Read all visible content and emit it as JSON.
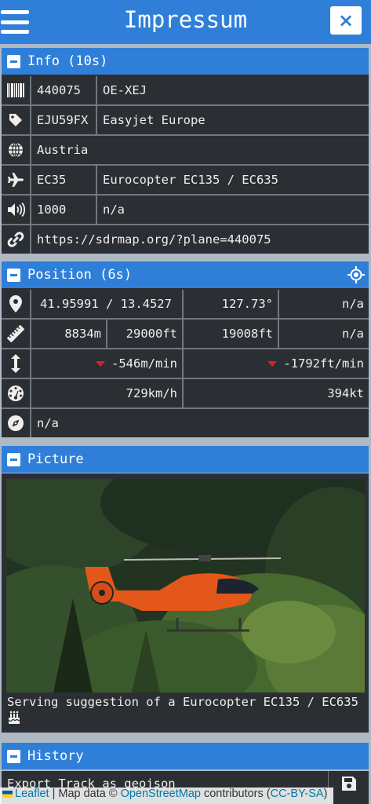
{
  "header": {
    "title": "Impressum",
    "close_label": "×"
  },
  "sections": {
    "info": {
      "title": "Info (10s)"
    },
    "position": {
      "title": "Position (6s)"
    },
    "picture": {
      "title": "Picture"
    },
    "history": {
      "title": "History"
    }
  },
  "info": {
    "hex": "440075",
    "registration": "OE-XEJ",
    "callsign": "EJU59FX",
    "operator": "Easyjet Europe",
    "country": "Austria",
    "type_code": "EC35",
    "type_name": "Eurocopter EC135 / EC635",
    "squawk": "1000",
    "squawk_extra": "n/a",
    "link": "https://sdrmap.org/?plane=440075"
  },
  "position": {
    "coords": "41.95991 / 13.4527",
    "track": "127.73°",
    "pos_extra": "n/a",
    "alt_m": "8834m",
    "alt_ft": "29000ft",
    "geo_alt_ft": "19008ft",
    "alt_extra": "n/a",
    "vrate_m": "-546m/min",
    "vrate_ft": "-1792ft/min",
    "speed_kmh": "729km/h",
    "speed_kt": "394kt",
    "heading": "n/a"
  },
  "picture": {
    "caption": "Serving suggestion of a Eurocopter EC135 / EC635"
  },
  "history": {
    "export_label": "Export Track as geojson"
  },
  "attribution": {
    "leaflet": "Leaflet",
    "sep": " | Map data © ",
    "osm": "OpenStreetMap",
    "contributors": " contributors (",
    "license": "CC-BY-SA",
    "close": ")"
  },
  "colors": {
    "accent": "#2f7fd9",
    "panel": "#2b2f33",
    "down_arrow": "#e02020"
  },
  "icons": [
    "menu-icon",
    "close-icon",
    "barcode-icon",
    "tag-icon",
    "globe-icon",
    "plane-icon",
    "volume-icon",
    "link-icon",
    "map-marker-icon",
    "ruler-icon",
    "vertical-arrows-icon",
    "speedometer-icon",
    "compass-icon",
    "crosshair-icon",
    "cake-icon",
    "save-icon"
  ]
}
